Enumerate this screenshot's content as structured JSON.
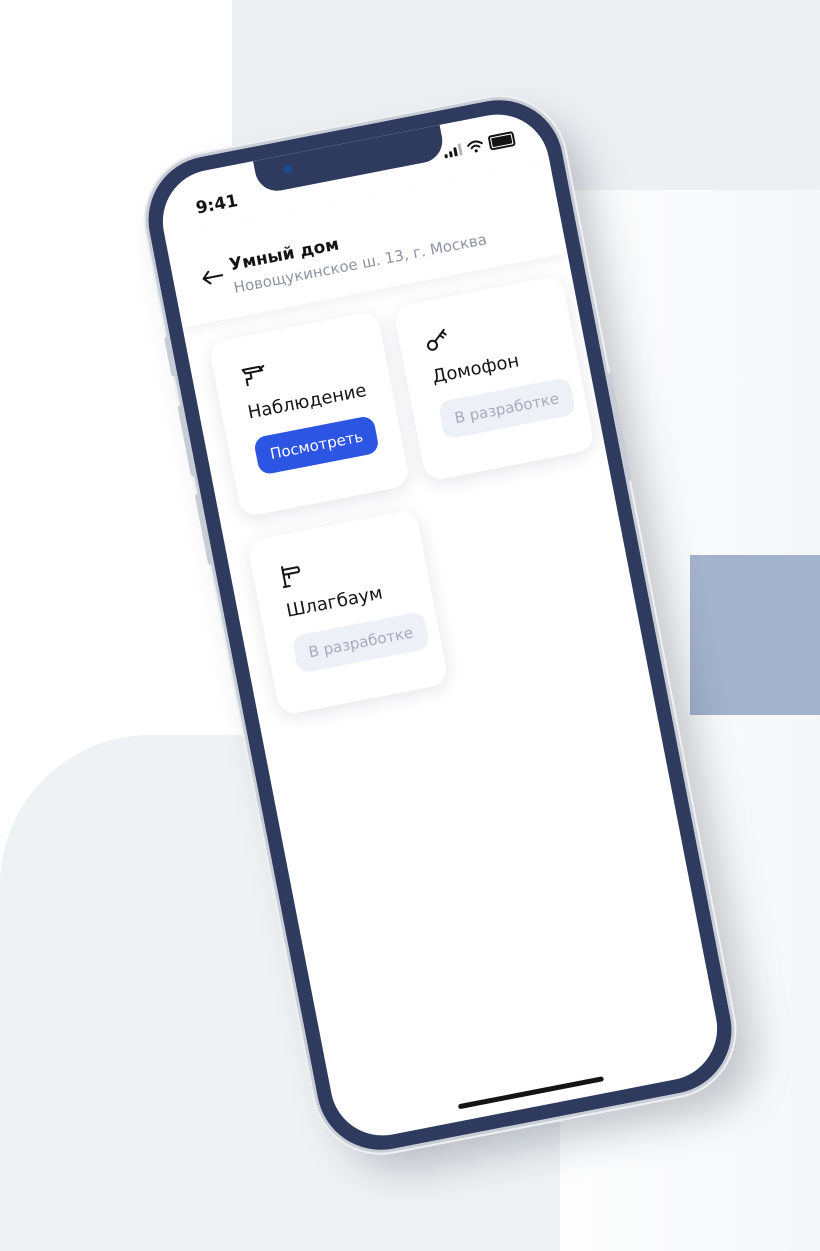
{
  "status": {
    "time": "9:41"
  },
  "header": {
    "title": "Умный дом",
    "address": "Новощукинское ш. 13, г. Москва"
  },
  "cards": [
    {
      "label": "Наблюдение",
      "action": "Посмотреть",
      "icon": "camera-icon"
    },
    {
      "label": "Домофон",
      "action": "В разработке",
      "icon": "key-icon"
    },
    {
      "label": "Шлагбаум",
      "action": "В разработке",
      "icon": "barrier-icon"
    }
  ],
  "colors": {
    "accent": "#2d55e3",
    "frame": "#2e3a5e",
    "muted_badge": "#eef0f8",
    "muted_text": "#a5abbb"
  }
}
